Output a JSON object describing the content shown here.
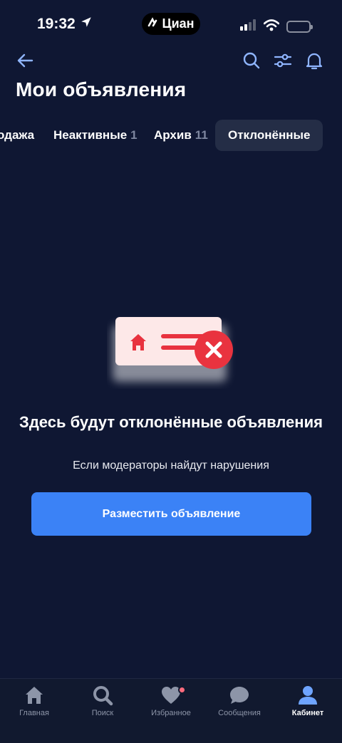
{
  "status_bar": {
    "time": "19:32",
    "island_label": "Циан",
    "icons": [
      "location-arrow-icon",
      "cellular-icon",
      "wifi-icon",
      "battery-icon"
    ]
  },
  "header": {
    "title": "Мои объявления",
    "icons": [
      "back-arrow-icon",
      "search-icon",
      "filter-sliders-icon",
      "bell-icon"
    ],
    "accent_color": "#8fb5ff"
  },
  "tabs": [
    {
      "label": "одажа",
      "count": ""
    },
    {
      "label": "Неактивные",
      "count": "1"
    },
    {
      "label": "Архив",
      "count": "11"
    },
    {
      "label": "Отклонённые",
      "count": "",
      "active": true
    }
  ],
  "empty_state": {
    "illustration_icons": [
      "house-icon",
      "reject-x-icon"
    ],
    "title": "Здесь будут отклонённые объявления",
    "subtitle": "Если модераторы найдут нарушения",
    "button_label": "Разместить объявление",
    "button_color": "#3b82f6"
  },
  "bottom_nav": {
    "items": [
      {
        "label": "Главная",
        "icon": "home-icon"
      },
      {
        "label": "Поиск",
        "icon": "search-icon"
      },
      {
        "label": "Избранное",
        "icon": "heart-icon",
        "badge": true
      },
      {
        "label": "Сообщения",
        "icon": "chat-icon"
      },
      {
        "label": "Кабинет",
        "icon": "user-icon",
        "active": true
      }
    ],
    "inactive_color": "#8d95a8",
    "active_color": "#ffffff",
    "badge_color": "#ff6b7d"
  },
  "colors": {
    "background": "#0f1733",
    "tab_active_bg": "#242d46"
  }
}
